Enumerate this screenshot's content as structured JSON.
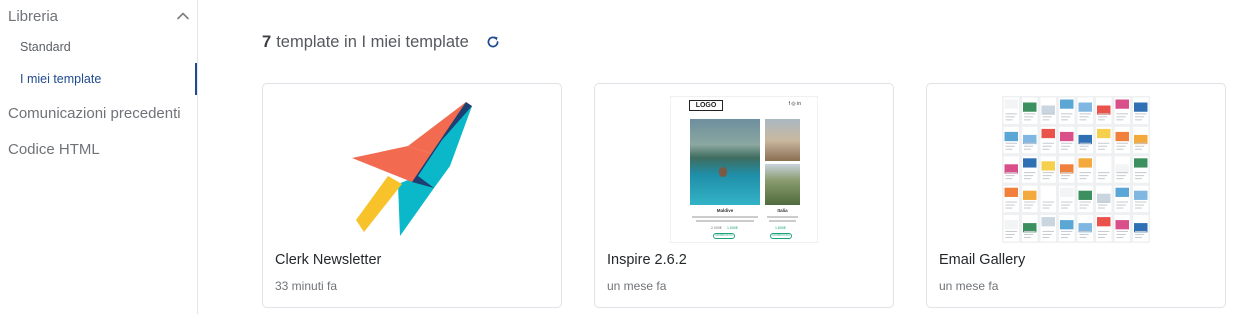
{
  "sidebar": {
    "library_label": "Libreria",
    "sub_items": [
      {
        "label": "Standard"
      },
      {
        "label": "I miei template"
      }
    ],
    "previous_label": "Comunicazioni precedenti",
    "html_label": "Codice HTML"
  },
  "header": {
    "count": "7",
    "label": "template in I miei template"
  },
  "cards": [
    {
      "title": "Clerk Newsletter",
      "time": "33 minuti fa"
    },
    {
      "title": "Inspire 2.6.2",
      "time": "un mese fa",
      "preview": {
        "logo": "LOGO",
        "social": "f ◎ in",
        "left_name": "Maldive",
        "right_name": "Italia",
        "left_price": "2.000€",
        "left_price2": "1.500€",
        "right_price": "1.800€",
        "btn": "SCOPRI DI PIÙ"
      }
    },
    {
      "title": "Email Gallery",
      "time": "un mese fa"
    }
  ],
  "colors": {
    "accent": "#1f4b8e",
    "logo_coral": "#f26a4f",
    "logo_navy": "#1d3f72",
    "logo_yellow": "#f8c22b",
    "logo_teal": "#0ab8c9"
  }
}
